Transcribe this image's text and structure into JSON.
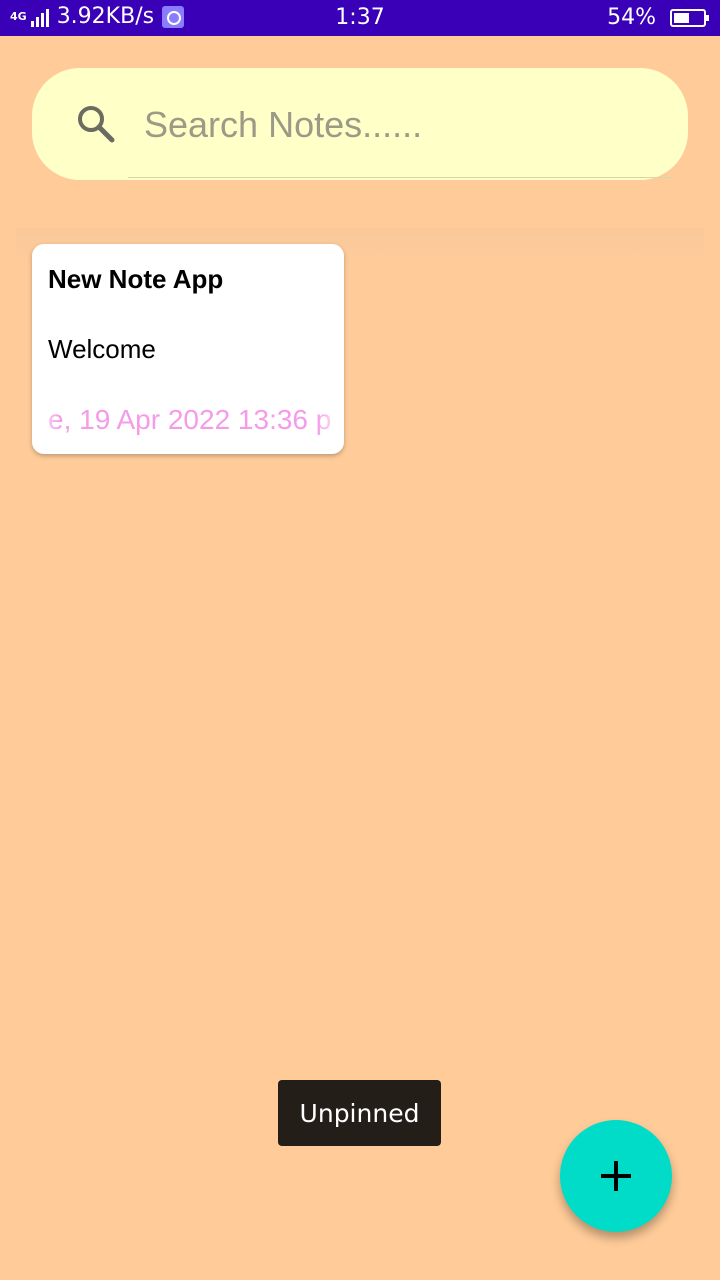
{
  "status_bar": {
    "network_type": "4G",
    "net_speed": "3.92KB/s",
    "time": "1:37",
    "battery_percent": "54%",
    "battery_level": 0.54,
    "background_color": "#3A00B8"
  },
  "search": {
    "placeholder": "Search Notes......",
    "value": "",
    "icon": "search-icon"
  },
  "notes": [
    {
      "title": "New Note App",
      "body": "Welcome",
      "date_visible": "e, 19 Apr 2022 13:36 p"
    }
  ],
  "toast": {
    "message": "Unpinned"
  },
  "fab": {
    "icon": "plus-icon",
    "color": "#00DCC8"
  },
  "theme": {
    "background": "#FFCC99",
    "search_bg": "#FFFFC8",
    "date_color": "#F59BE8"
  }
}
